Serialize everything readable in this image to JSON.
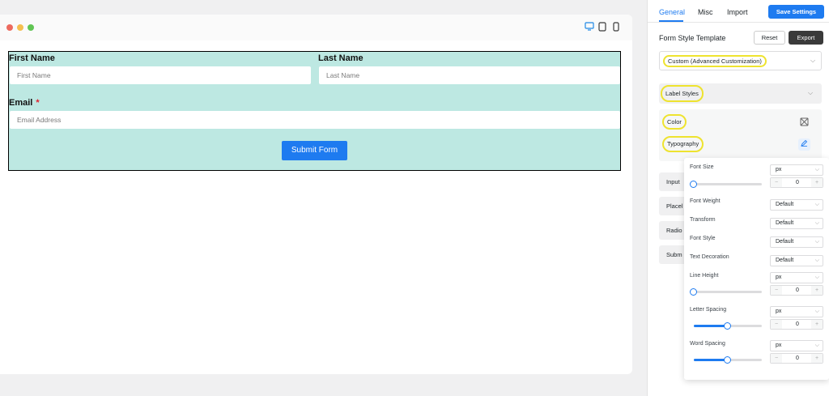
{
  "preview": {
    "window_dots": [
      "#ed6a5e",
      "#f5bf4f",
      "#61c554"
    ],
    "device_icons": [
      {
        "icon": "desktop-icon",
        "glyph": "🖵",
        "active": true
      },
      {
        "icon": "tablet-icon",
        "glyph": "▯",
        "active": false
      },
      {
        "icon": "mobile-icon",
        "glyph": "▯",
        "active": false
      }
    ],
    "form": {
      "background": "#bde8e2",
      "first_name_label": "First Name",
      "first_name_placeholder": "First Name",
      "last_name_label": "Last Name",
      "last_name_placeholder": "Last Name",
      "email_label": "Email",
      "email_required": "*",
      "email_placeholder": "Email Address",
      "submit_label": "Submit Form"
    }
  },
  "panel": {
    "tabs": [
      "General",
      "Misc",
      "Import"
    ],
    "active_tab": "General",
    "save_label": "Save Settings",
    "template_title": "Form Style Template",
    "reset_label": "Reset",
    "export_label": "Export",
    "template_value": "Custom (Advanced Customization)",
    "label_styles": {
      "title": "Label Styles",
      "color_label": "Color",
      "typography_label": "Typography"
    },
    "collapsed_sections": [
      "Input",
      "Placel",
      "Radio",
      "Subm"
    ],
    "highlight_color": "#eee32f"
  },
  "typography": {
    "font_size": {
      "label": "Font Size",
      "unit": "px",
      "value": "0",
      "slider": 0
    },
    "font_weight": {
      "label": "Font Weight",
      "value": "Default"
    },
    "transform": {
      "label": "Transform",
      "value": "Default"
    },
    "font_style": {
      "label": "Font Style",
      "value": "Default"
    },
    "text_decoration": {
      "label": "Text Decoration",
      "value": "Default"
    },
    "line_height": {
      "label": "Line Height",
      "unit": "px",
      "value": "0",
      "slider": 0
    },
    "letter_spacing": {
      "label": "Letter Spacing",
      "unit": "px",
      "value": "0",
      "slider": 0.5
    },
    "word_spacing": {
      "label": "Word Spacing",
      "unit": "px",
      "value": "0",
      "slider": 0.5
    },
    "stepper_minus": "−",
    "stepper_plus": "+"
  }
}
